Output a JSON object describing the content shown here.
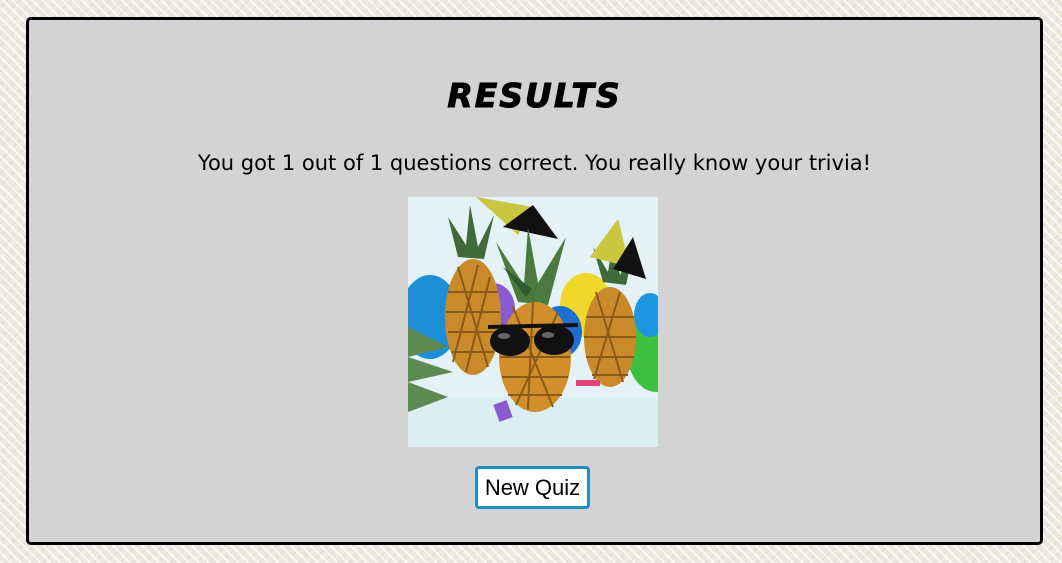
{
  "results": {
    "title": "Results",
    "message": "You got 1 out of 1 questions correct. You really know your trivia!",
    "image_alt": "pineapples wearing party hats and sunglasses",
    "new_quiz_label": "New Quiz"
  },
  "colors": {
    "panel_background": "#d3d3d3",
    "panel_border": "#000000",
    "button_border": "#1e8fc0",
    "button_background": "#ffffff",
    "page_background": "#ece9dc"
  }
}
